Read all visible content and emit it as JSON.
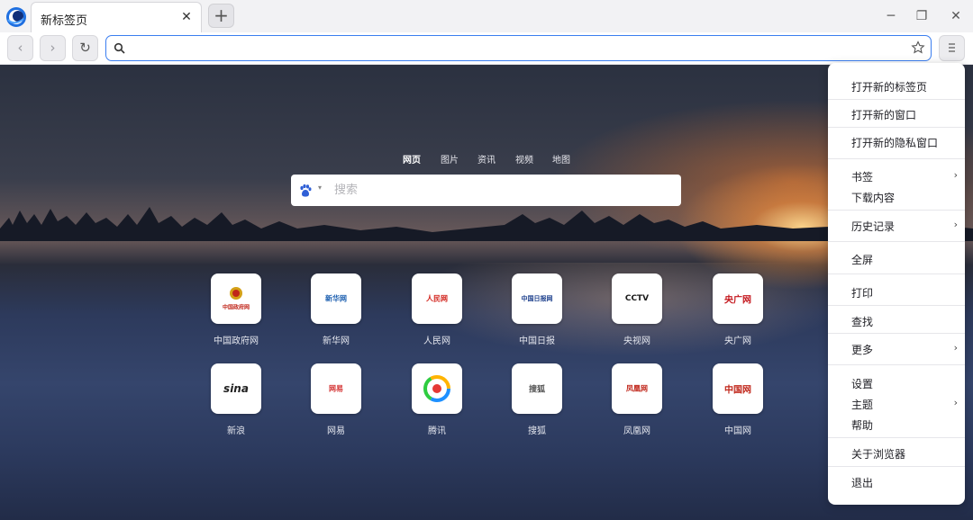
{
  "tabs": {
    "active_title": "新标签页",
    "close_glyph": "✕",
    "new_tab_glyph": "+"
  },
  "window_controls": {
    "minimize": "─",
    "maximize": "❐",
    "close": "✕"
  },
  "toolbar": {
    "back_glyph": "‹",
    "forward_glyph": "›",
    "reload_glyph": "↻",
    "address_value": "",
    "accent_color": "#3b7ef0"
  },
  "search": {
    "categories": [
      "网页",
      "图片",
      "资讯",
      "视频",
      "地图"
    ],
    "active_category": "网页",
    "placeholder": "搜索",
    "engine_icon": "baidu-paw-icon"
  },
  "shortcuts": [
    {
      "label": "中国政府网",
      "mark": "中国政府网",
      "color": "#c0261a"
    },
    {
      "label": "新华网",
      "mark": "新华网",
      "color": "#1c5fb0"
    },
    {
      "label": "人民网",
      "mark": "人民网",
      "color": "#d2231c"
    },
    {
      "label": "中国日报",
      "mark": "中国日报网",
      "color": "#1c3f8c"
    },
    {
      "label": "央视网",
      "mark": "CCTV",
      "color": "#1a1a1a"
    },
    {
      "label": "央广网",
      "mark": "央广网",
      "color": "#c4161c"
    },
    {
      "label": "新浪",
      "mark": "sina",
      "color": "#222"
    },
    {
      "label": "网易",
      "mark": "网易",
      "color": "#d32f2f"
    },
    {
      "label": "腾讯",
      "mark": "",
      "color": "#1e90ff"
    },
    {
      "label": "搜狐",
      "mark": "搜狐",
      "color": "#555"
    },
    {
      "label": "凤凰网",
      "mark": "凤凰网",
      "color": "#c0261a"
    },
    {
      "label": "中国网",
      "mark": "中国网",
      "color": "#c0261a"
    }
  ],
  "menu": {
    "items": [
      {
        "label": "打开新的标签页",
        "submenu": false
      },
      {
        "label": "打开新的窗口",
        "submenu": false
      },
      {
        "label": "打开新的隐私窗口",
        "submenu": false
      },
      {
        "label": "书签",
        "submenu": true
      },
      {
        "label": "下载内容",
        "submenu": false
      },
      {
        "label": "历史记录",
        "submenu": true
      },
      {
        "label": "全屏",
        "submenu": false
      },
      {
        "label": "打印",
        "submenu": false
      },
      {
        "label": "查找",
        "submenu": false
      },
      {
        "label": "更多",
        "submenu": true
      },
      {
        "label": "设置",
        "submenu": false
      },
      {
        "label": "主题",
        "submenu": true
      },
      {
        "label": "帮助",
        "submenu": false
      },
      {
        "label": "关于浏览器",
        "submenu": false
      },
      {
        "label": "退出",
        "submenu": false
      }
    ],
    "arrow_glyph": "›"
  }
}
